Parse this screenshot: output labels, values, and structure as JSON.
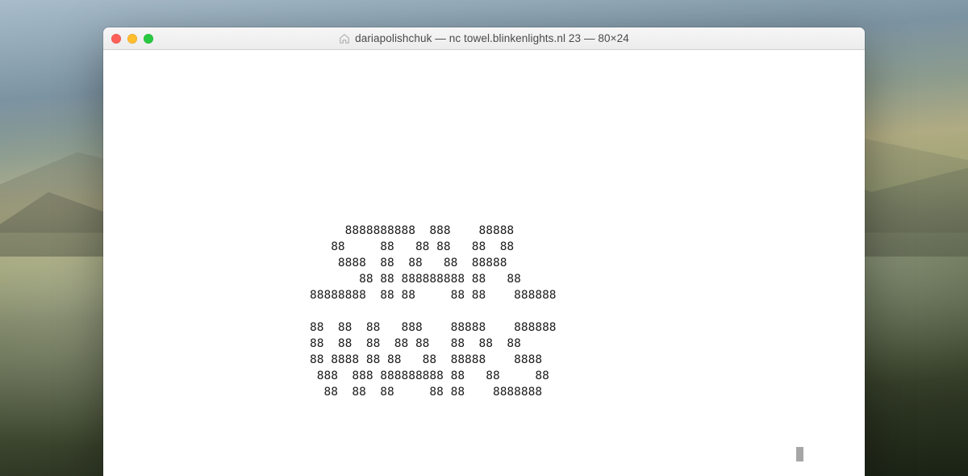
{
  "window": {
    "title": "dariapolishchuk — nc towel.blinkenlights.nl 23 — 80×24"
  },
  "terminal": {
    "ascii_lines": [
      "     8888888888  888    88888",
      "   88     88   88 88   88  88",
      "    8888  88  88   88  88888",
      "       88 88 888888888 88   88",
      "88888888  88 88     88 88    888888",
      "",
      "88  88  88   888    88888    888888",
      "88  88  88  88 88   88  88  88",
      "88 8888 88 88   88  88888    8888",
      " 888  888 888888888 88   88     88",
      "  88  88  88     88 88    8888888"
    ]
  }
}
